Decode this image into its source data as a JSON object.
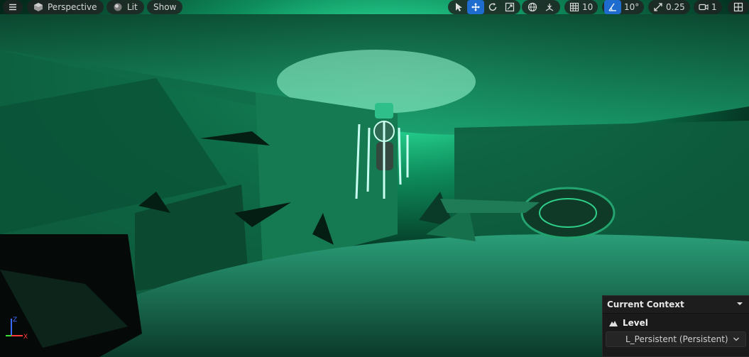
{
  "toolbar": {
    "menu_icon": "hamburger-icon",
    "perspective_label": "Perspective",
    "lit_label": "Lit",
    "show_label": "Show",
    "grid_snap_value": "10",
    "angle_snap_value": "10°",
    "scale_snap_value": "0.25",
    "camera_speed_value": "1"
  },
  "context_panel": {
    "title": "Current Context",
    "level_label": "Level",
    "level_value": "L_Persistent (Persistent)"
  },
  "axis": {
    "z": "Z",
    "x": "X",
    "y": "Y"
  },
  "colors": {
    "accent_blue": "#1f6ccf",
    "scene_green": "#1fd38a"
  }
}
